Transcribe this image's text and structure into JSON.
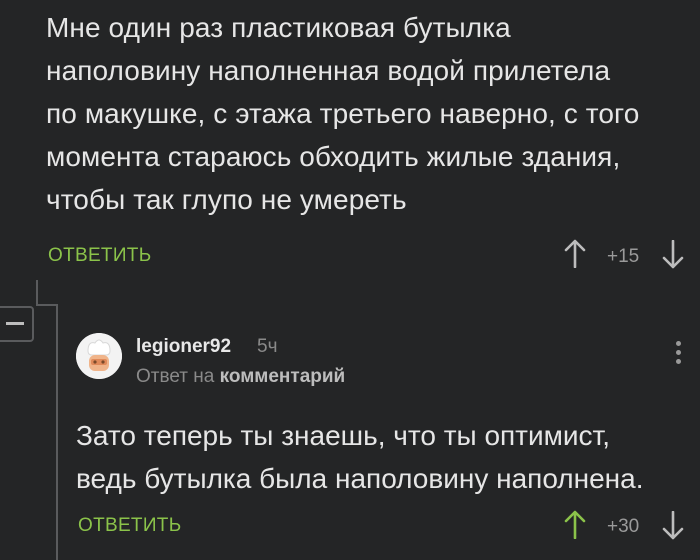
{
  "comment": {
    "text_lines": [
      "Мне один раз пластиковая бутылка",
      "наполовину наполненная водой прилетела",
      "по макушке, с этажа третьего наверно, с того",
      "момента стараюсь обходить жилые здания,",
      "чтобы так глупо не умереть"
    ],
    "reply_label": "ОТВЕТИТЬ",
    "score": "+15",
    "up_icon": "arrow-up-icon",
    "down_icon": "arrow-down-icon"
  },
  "thread": {
    "collapse_icon": "minus-icon"
  },
  "reply": {
    "username": "legioner92",
    "time": "5ч",
    "reply_to_prefix": "Ответ на",
    "reply_to_target": "комментарий",
    "text_lines": [
      "Зато теперь ты знаешь, что ты оптимист,",
      "ведь бутылка была наполовину наполнена."
    ],
    "reply_label": "ОТВЕТИТЬ",
    "score": "+30",
    "up_voted": true,
    "more_icon": "more-vertical-icon",
    "avatar_icon": "chef-avatar-icon"
  },
  "colors": {
    "background": "#242526",
    "accent_green": "#8bc34a",
    "text": "#e6e6e6",
    "muted": "#8a8a8a"
  }
}
